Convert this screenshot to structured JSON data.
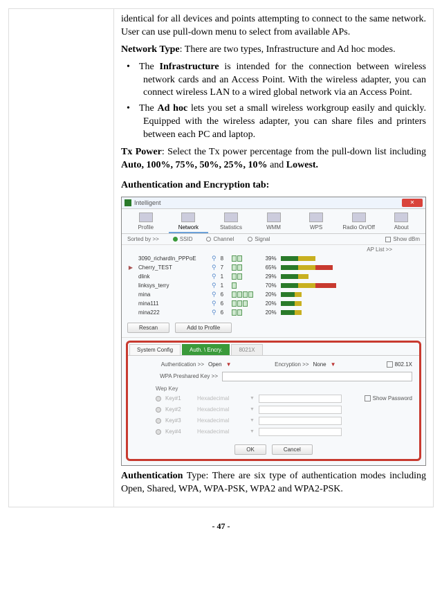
{
  "doc": {
    "para_intro": "identical for all devices and points attempting to connect to the same network. User can use pull-down menu to select from available APs.",
    "network_type_label": "Network Type",
    "network_type_text": ": There are two types, Infrastructure and Ad hoc modes.",
    "bullets": [
      {
        "bold": "Infrastructure",
        "pre": "The ",
        "post": " is intended for the connection between wireless network cards and an Access Point. With the wireless adapter, you can connect wireless LAN to a wired global network via an Access Point."
      },
      {
        "bold": "Ad hoc",
        "pre": "The ",
        "post": " lets you set a small wireless workgroup easily and quickly. Equipped with the wireless adapter, you can share files and printers between each PC and laptop."
      }
    ],
    "tx_power_label": "Tx Power",
    "tx_power_text": ": Select the Tx power percentage from the pull-down list including ",
    "tx_power_bold": "Auto, 100%, 75%, 50%, 25%, 10%",
    "tx_power_and": " and ",
    "tx_power_lowest": "Lowest.",
    "auth_encrypt_heading": "Authentication and Encryption tab:",
    "auth_label": "Authentication",
    "auth_text": " Type: There are six type of authentication modes including Open, Shared, WPA, WPA-PSK, WPA2 and WPA2-PSK.",
    "page_number": "- 47 -"
  },
  "screenshot": {
    "window_title": "Intelligent",
    "close": "✕",
    "main_tabs": [
      "Profile",
      "Network",
      "Statistics",
      "WMM",
      "WPS",
      "Radio On/Off",
      "About"
    ],
    "selected_main_tab": 1,
    "sort_label": "Sorted by >>",
    "sort_options": [
      "SSID",
      "Channel",
      "Signal"
    ],
    "sort_selected": 0,
    "show_dbm": "Show dBm",
    "ap_list_label": "AP List >>",
    "ap_rows": [
      {
        "arrow": "",
        "ssid": "3090_richardIn_PPPoE",
        "ch": "8",
        "enc": 2,
        "blank": 2,
        "pct": "39%",
        "g": 25,
        "y": 25,
        "r": 0
      },
      {
        "arrow": "▶",
        "ssid": "Cherry_TEST",
        "ch": "7",
        "enc": 2,
        "blank": 2,
        "pct": "65%",
        "g": 25,
        "y": 25,
        "r": 25
      },
      {
        "arrow": "",
        "ssid": "dlink",
        "ch": "1",
        "enc": 2,
        "blank": 2,
        "pct": "29%",
        "g": 25,
        "y": 15,
        "r": 0
      },
      {
        "arrow": "",
        "ssid": "linksys_terry",
        "ch": "1",
        "enc": 1,
        "blank": 3,
        "pct": "70%",
        "g": 25,
        "y": 25,
        "r": 30
      },
      {
        "arrow": "",
        "ssid": "mina",
        "ch": "6",
        "enc": 4,
        "blank": 0,
        "pct": "20%",
        "g": 20,
        "y": 10,
        "r": 0
      },
      {
        "arrow": "",
        "ssid": "mina111",
        "ch": "6",
        "enc": 3,
        "blank": 1,
        "pct": "20%",
        "g": 20,
        "y": 10,
        "r": 0
      },
      {
        "arrow": "",
        "ssid": "mina222",
        "ch": "6",
        "enc": 2,
        "blank": 2,
        "pct": "20%",
        "g": 20,
        "y": 10,
        "r": 0
      }
    ],
    "rescan": "Rescan",
    "add_profile": "Add to Profile",
    "cfg_tabs": {
      "sys": "System Config",
      "auth": "Auth. \\ Encry.",
      "x8021": "8021X"
    },
    "auth_label": "Authentication >>",
    "auth_value": "Open",
    "enc_label": "Encryption >>",
    "enc_value": "None",
    "dot1x": "802.1X",
    "psk_label": "WPA Preshared Key >>",
    "wep_title": "Wep Key",
    "wep_keys": [
      "Key#1",
      "Key#2",
      "Key#3",
      "Key#4"
    ],
    "wep_type": "Hexadecimal",
    "show_password": "Show Password",
    "ok": "OK",
    "cancel": "Cancel"
  }
}
